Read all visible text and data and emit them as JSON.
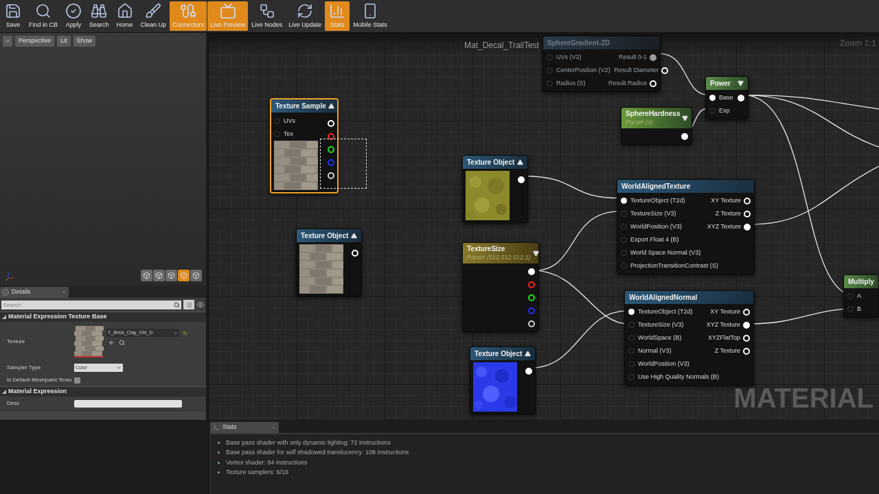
{
  "toolbar": [
    {
      "label": "Save",
      "on": false
    },
    {
      "label": "Find in CB",
      "on": false
    },
    {
      "label": "Apply",
      "on": false
    },
    {
      "label": "Search",
      "on": false
    },
    {
      "label": "Home",
      "on": false
    },
    {
      "label": "Clean Up",
      "on": false
    },
    {
      "label": "Connectors",
      "on": true
    },
    {
      "label": "Live Preview",
      "on": true
    },
    {
      "label": "Live Nodes",
      "on": false
    },
    {
      "label": "Live Update",
      "on": false
    },
    {
      "label": "Stats",
      "on": true
    },
    {
      "label": "Mobile Stats",
      "on": false
    }
  ],
  "viewport": {
    "buttons": [
      "Perspective",
      "Lit",
      "Show"
    ]
  },
  "details": {
    "tab": "Details",
    "search": {
      "placeholder": "Search"
    },
    "sections": [
      {
        "title": "Material Expression Texture Base",
        "expanded": true,
        "rows": [
          {
            "kind": "texture",
            "label": "Texture",
            "value": "T_Brick_Clay_Old_D"
          },
          {
            "kind": "select",
            "label": "Sampler Type",
            "value": "Color"
          },
          {
            "kind": "checkbox",
            "label": "Is Default Meshpaint Textu",
            "checked": false
          }
        ]
      },
      {
        "title": "Material Expression",
        "expanded": true,
        "rows": [
          {
            "kind": "text",
            "label": "Desc"
          }
        ]
      }
    ]
  },
  "graph": {
    "title": "Mat_Decal_TrailTest",
    "zoom": "Zoom 1:1",
    "type_label": "MATERIAL",
    "nodes": [
      {
        "title": "SphereGradient-2D",
        "kind": "function",
        "selected": false,
        "inputs": [
          {
            "label": "UVs (V2)",
            "connected": false
          },
          {
            "label": "CenterPosition (V2)",
            "connected": false
          },
          {
            "label": "Radius (S)",
            "connected": false
          }
        ],
        "outputs": [
          {
            "label": "Result 0-1",
            "connected": true,
            "color": "#9a9a9a"
          },
          {
            "label": "Result Diameter",
            "connected": false,
            "color": "#ffffff"
          },
          {
            "label": "Result Radius",
            "connected": false,
            "color": "#ffffff"
          }
        ]
      },
      {
        "title": "Power",
        "kind": "math",
        "selected": false,
        "expanded": false,
        "inputs": [
          {
            "label": "Base",
            "connected": true
          },
          {
            "label": "Exp",
            "connected": false
          }
        ],
        "outputs": [
          {
            "connected": true,
            "color": "#ffffff"
          }
        ]
      },
      {
        "title": "Texture Sample",
        "kind": "texture",
        "selected": true,
        "expanded": true,
        "preview": {
          "kind": "picture"
        },
        "inputs": [
          {
            "label": "UVs",
            "connected": false
          },
          {
            "label": "Tex",
            "connected": false
          }
        ],
        "outputs": [
          {
            "connected": false,
            "color": "#ffffff"
          },
          {
            "connected": false,
            "color": "#ff2020"
          },
          {
            "connected": false,
            "color": "#20e020"
          },
          {
            "connected": false,
            "color": "#2030ff"
          },
          {
            "connected": false,
            "color": "#d0d0d0"
          }
        ]
      },
      {
        "title": "SphereHardness",
        "subtitle": "Param (4)",
        "kind": "scalar",
        "selected": false,
        "expanded": false,
        "outputs": [
          {
            "connected": true,
            "color": "#ffffff"
          }
        ]
      },
      {
        "title": "Texture Object",
        "kind": "texture",
        "selected": false,
        "expanded": true,
        "preview": {
          "kind": "picture"
        },
        "outputs": [
          {
            "connected": true,
            "color": "#ffffff"
          }
        ]
      },
      {
        "title": "WorldAlignedTexture",
        "kind": "texture",
        "selected": false,
        "inputs": [
          {
            "label": "TextureObject (T2d)",
            "connected": true
          },
          {
            "label": "TextureSize (V3)",
            "connected": false
          },
          {
            "label": "WorldPosition (V3)",
            "connected": false
          },
          {
            "label": "Export Float 4 (B)",
            "connected": false
          },
          {
            "label": "World Space Normal (V3)",
            "connected": false
          },
          {
            "label": "ProjectionTransitionContrast (S)",
            "connected": false
          }
        ],
        "outputs": [
          {
            "label": "XY Texture",
            "connected": false,
            "color": "#ffffff"
          },
          {
            "label": "Z Texture",
            "connected": false,
            "color": "#ffffff"
          },
          {
            "label": "XYZ Texture",
            "connected": true,
            "color": "#ffffff"
          }
        ]
      },
      {
        "title": "Texture Object",
        "kind": "texture",
        "selected": false,
        "expanded": true,
        "preview": {
          "kind": "picture"
        },
        "outputs": [
          {
            "connected": false,
            "color": "#ffffff"
          }
        ]
      },
      {
        "title": "TextureSize",
        "subtitle": "Param (512,512,512,1)",
        "kind": "vector",
        "selected": false,
        "expanded": false,
        "outputs": [
          {
            "connected": true,
            "color": "#ffffff"
          },
          {
            "connected": false,
            "color": "#ff2020"
          },
          {
            "connected": false,
            "color": "#20e020"
          },
          {
            "connected": false,
            "color": "#2030ff"
          },
          {
            "connected": false,
            "color": "#d0d0d0"
          }
        ]
      },
      {
        "title": "Multiply",
        "kind": "math",
        "selected": false,
        "inputs": [
          {
            "label": "A",
            "connected": false
          },
          {
            "label": "B",
            "connected": false
          }
        ]
      },
      {
        "title": "WorldAlignedNormal",
        "kind": "texture",
        "selected": false,
        "inputs": [
          {
            "label": "TextureObject (T2d)",
            "connected": true
          },
          {
            "label": "TextureSize (V3)",
            "connected": false
          },
          {
            "label": "WorldSpace (B)",
            "connected": false
          },
          {
            "label": "Normal (V3)",
            "connected": false
          },
          {
            "label": "WorldPosition (V3)",
            "connected": false
          },
          {
            "label": "Use High Quality Normals (B)",
            "connected": false
          }
        ],
        "outputs": [
          {
            "label": "XY Texture",
            "connected": false,
            "color": "#ffffff"
          },
          {
            "label": "XYZ Texture",
            "connected": true,
            "color": "#ffffff"
          },
          {
            "label": "XYZFlatTop",
            "connected": false,
            "color": "#ffffff"
          },
          {
            "label": "Z Texture",
            "connected": false,
            "color": "#ffffff"
          }
        ]
      },
      {
        "title": "Texture Object",
        "kind": "texture",
        "selected": false,
        "expanded": true,
        "preview": {
          "kind": "picture"
        },
        "outputs": [
          {
            "connected": true,
            "color": "#ffffff"
          }
        ]
      }
    ]
  },
  "stats": {
    "tab": "Stats",
    "lines": [
      "Base pass shader with only dynamic lighting: 72 instructions",
      "Base pass shader for self shadowed translucency: 108 instructions",
      "Vertex shader: 84 instructions",
      "Texture samplers: 6/16"
    ]
  }
}
